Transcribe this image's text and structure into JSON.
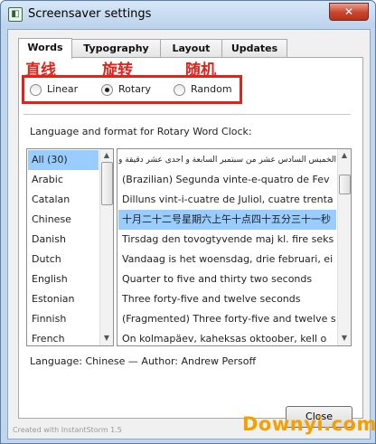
{
  "window": {
    "title": "Screensaver settings",
    "close_glyph": "✕",
    "app_icon_glyph": "◧"
  },
  "tabs": [
    {
      "label": "Words",
      "active": true
    },
    {
      "label": "Typography",
      "active": false
    },
    {
      "label": "Layout",
      "active": false
    },
    {
      "label": "Updates",
      "active": false
    }
  ],
  "annotations": {
    "linear": "直线",
    "rotary": "旋转",
    "random": "随机",
    "color": "#e2231a"
  },
  "modes": [
    {
      "label": "Linear",
      "selected": false
    },
    {
      "label": "Rotary",
      "selected": true
    },
    {
      "label": "Random",
      "selected": false
    }
  ],
  "heading": "Language and format for Rotary Word Clock:",
  "languages": [
    "All (30)",
    "Arabic",
    "Catalan",
    "Chinese",
    "Danish",
    "Dutch",
    "English",
    "Estonian",
    "Finnish",
    "French"
  ],
  "selected_language": "All (30)",
  "formats": [
    "الخميس السادس عشر من سبتمبر السابعة و احدى عشر دقيقة و مساءاً و حد",
    "(Brazilian) Segunda vinte-e-quatro de Fev",
    "Dilluns vint-i-cuatre de Juliol, cuatre trenta",
    "十月二十二号星期六上午十点四十五分三十一秒",
    "Tirsdag den tovogtyvende maj kl. fire seks",
    "Vandaag is het woensdag, drie februari, ei",
    "Quarter to five and thirty two seconds",
    "Three forty-five and twelve seconds",
    "(Fragmented) Three forty-five and twelve s",
    "On kolmapäev, kaheksas oktoober, kell o"
  ],
  "selected_format_index": 3,
  "status": "Language: Chinese — Author: Andrew Persoff",
  "footer": "Created with InstantStorm 1.5",
  "close_button": "Close",
  "watermark": "Downyi.com",
  "scroll_arrows": {
    "up": "▲",
    "down": "▼"
  }
}
